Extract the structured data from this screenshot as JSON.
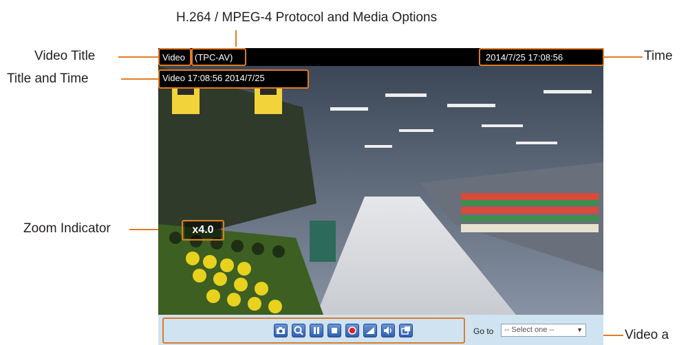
{
  "annotations": {
    "protocol_options": "H.264 / MPEG-4 Protocol and Media Options",
    "video_title": "Video Title",
    "title_and_time": "Title and Time",
    "zoom_indicator": "Zoom Indicator",
    "time": "Time",
    "video_and_controls": "Video a"
  },
  "viewer": {
    "title": "Video",
    "protocol": "(TPC-AV)",
    "datetime": "2014/7/25  17:08:56",
    "overlay_title_time": "Video 17:08:56  2014/7/25",
    "zoom": "x4.0",
    "goto_label": "Go to",
    "goto_select": "-- Select one --",
    "controls": [
      "snapshot-icon",
      "zoom-icon",
      "pause-icon",
      "stop-icon",
      "record-icon",
      "volume-adjust-icon",
      "mute-icon",
      "fullscreen-icon"
    ]
  },
  "colors": {
    "callout": "#e07b23",
    "control_bar": "#cfe3f1"
  }
}
